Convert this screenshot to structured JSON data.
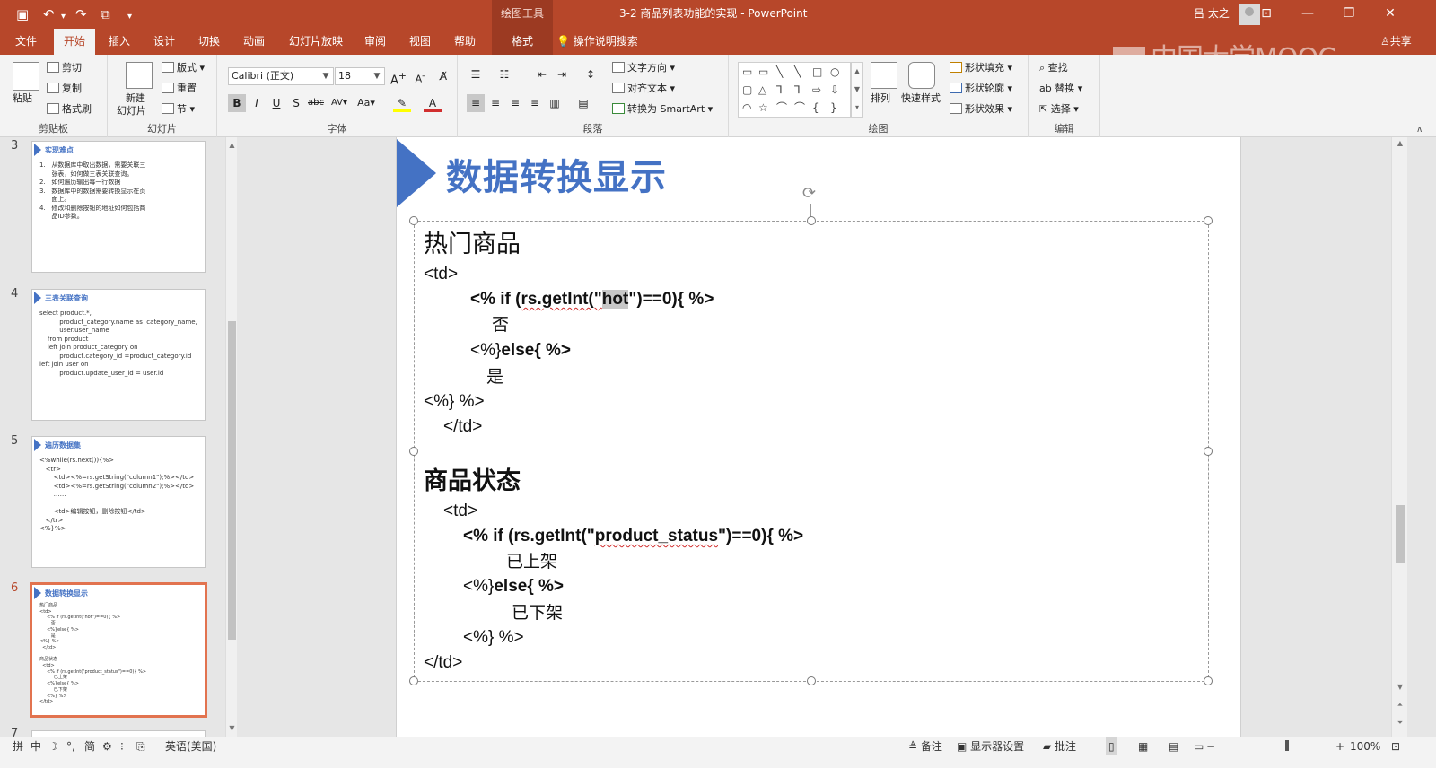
{
  "titlebar": {
    "contextual": "绘图工具",
    "doc_title": "3-2 商品列表功能的实现  -  PowerPoint",
    "user": "吕 太之",
    "btn_ribbon_opts": "⊡",
    "btn_min": "—",
    "btn_max": "❐",
    "btn_close": "✕"
  },
  "tabs": {
    "items": [
      "文件",
      "开始",
      "插入",
      "设计",
      "切换",
      "动画",
      "幻灯片放映",
      "审阅",
      "视图",
      "帮助",
      "格式"
    ],
    "tell_me": "操作说明搜索",
    "share": "共享"
  },
  "watermark": "中国大学MOOC",
  "ribbon": {
    "clipboard": {
      "label": "剪贴板",
      "paste": "粘贴",
      "cut": "剪切",
      "copy": "复制",
      "format_painter": "格式刷"
    },
    "slides": {
      "label": "幻灯片",
      "new_slide": "新建",
      "new_slide2": "幻灯片",
      "layout": "版式",
      "reset": "重置",
      "section": "节"
    },
    "font": {
      "label": "字体",
      "font_name": "Calibri (正文)",
      "font_size": "18"
    },
    "paragraph": {
      "label": "段落",
      "text_direction": "文字方向",
      "align_text": "对齐文本",
      "smartart": "转换为 SmartArt"
    },
    "drawing": {
      "label": "绘图",
      "arrange": "排列",
      "quick_styles": "快速样式",
      "shape_fill": "形状填充",
      "shape_outline": "形状轮廓",
      "shape_effects": "形状效果"
    },
    "editing": {
      "label": "编辑",
      "find": "查找",
      "replace": "替换",
      "select": "选择"
    }
  },
  "thumbnails": [
    {
      "num": "3",
      "title": "实现难点",
      "body": "1.   从数据库中取出数据，需要关联三\n      张表，如何做三表关联查询。\n2.   如何遍历输出每一行数据\n3.   数据库中的数据需要转换显示在页\n      面上。\n4.   修改和删除按钮的地址如何包括商\n      品ID参数。"
    },
    {
      "num": "4",
      "title": "三表关联查询",
      "body": "select product.*,\n          product_category.name as  category_name,\n          user.user_name\n    from product\n    left join product_category on\n          product.category_id =product_category.id\nleft join user on\n          product.update_user_id = user.id"
    },
    {
      "num": "5",
      "title": "遍历数据集",
      "body": "<%while(rs.next()){%>\n   <tr>\n       <td><%=rs.getString(\"column1\");%></td>\n       <td><%=rs.getString(\"column2\");%></td>\n       ……\n\n       <td>编辑按钮，删除按钮</td>\n   </tr>\n<%}%>"
    },
    {
      "num": "6",
      "title": "数据转换显示",
      "body": "热门商品\n<td>\n     <% if (rs.getInt(\"hot\")==0){ %>\n        否\n     <%}else{ %>\n        是\n<%} %>\n  </td>\n\n商品状态\n  <td>\n     <% if (rs.getInt(\"product_status\")==0){ %>\n          已上架\n     <%}else{ %>\n          已下架\n     <%} %>\n</td>"
    },
    {
      "num": "7"
    }
  ],
  "slide": {
    "title": "数据转换显示",
    "hot_heading": "热门商品",
    "l_td_open": "<td>",
    "l_if_pre": "<% if (",
    "l_if_fn": "rs.getInt(\"",
    "l_if_sel": "hot",
    "l_if_post": "\")==0){ %>",
    "l_no": "否",
    "l_else_a": "<%}",
    "l_else_b": "else{ %>",
    "l_yes": "是",
    "l_end": "<%} %>",
    "l_td_close": "</td>",
    "status_heading": "商品状态",
    "s_td_open": "<td>",
    "s_if_pre": "<% if (",
    "s_if_fn": "rs.getInt(\"",
    "s_if_sq": "product_status",
    "s_if_post": "\")==0){ %>",
    "s_on": "已上架",
    "s_else_a": "<%}",
    "s_else_b": "else{ %>",
    "s_off": "已下架",
    "s_end": "<%} %>",
    "s_td_close": "</td>"
  },
  "status": {
    "ime1": "拼",
    "ime2": "中",
    "ime3": "简",
    "language": "英语(美国)",
    "notes": "备注",
    "display_settings": "显示器设置",
    "comments": "批注",
    "zoom_minus": "−",
    "zoom_plus": "+",
    "zoom": "100%"
  }
}
